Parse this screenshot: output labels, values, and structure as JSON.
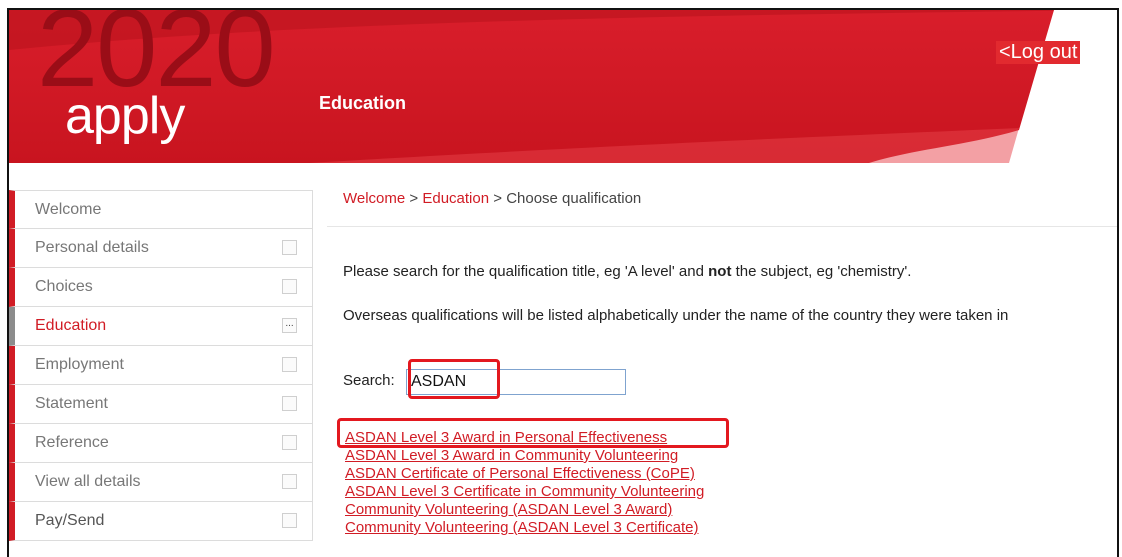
{
  "header": {
    "logo_year": "2020",
    "logo_word": "apply",
    "section_title": "Education",
    "logout_label": "<Log out"
  },
  "sidebar": {
    "items": [
      {
        "label": "Welcome",
        "has_check": false
      },
      {
        "label": "Personal details",
        "has_check": true
      },
      {
        "label": "Choices",
        "has_check": true
      },
      {
        "label": "Education",
        "has_check": true,
        "active": true,
        "check_mark": "..."
      },
      {
        "label": "Employment",
        "has_check": true
      },
      {
        "label": "Statement",
        "has_check": true
      },
      {
        "label": "Reference",
        "has_check": true
      },
      {
        "label": "View all details",
        "has_check": true
      },
      {
        "label": "Pay/Send",
        "has_check": true
      }
    ]
  },
  "breadcrumb": {
    "home": "Welcome",
    "sep1": " > ",
    "section": "Education",
    "sep2": " > ",
    "current": "Choose qualification"
  },
  "instructions": {
    "line1_pre": "Please search for the qualification title, eg 'A level' and ",
    "line1_bold": "not",
    "line1_post": " the subject, eg 'chemistry'.",
    "line2": "Overseas qualifications will be listed alphabetically under the name of the country they were taken in"
  },
  "search": {
    "label": "Search:",
    "value": "ASDAN"
  },
  "results": [
    "ASDAN Level 3 Award in Personal Effectiveness",
    "ASDAN Level 3 Award in Community Volunteering",
    "ASDAN Certificate of Personal Effectiveness (CoPE)",
    "ASDAN Level 3 Certificate in Community Volunteering",
    "Community Volunteering (ASDAN Level 3 Award)",
    "Community Volunteering (ASDAN Level 3 Certificate)"
  ],
  "colors": {
    "brand_red": "#d11c25",
    "highlight": "#e3181f"
  }
}
